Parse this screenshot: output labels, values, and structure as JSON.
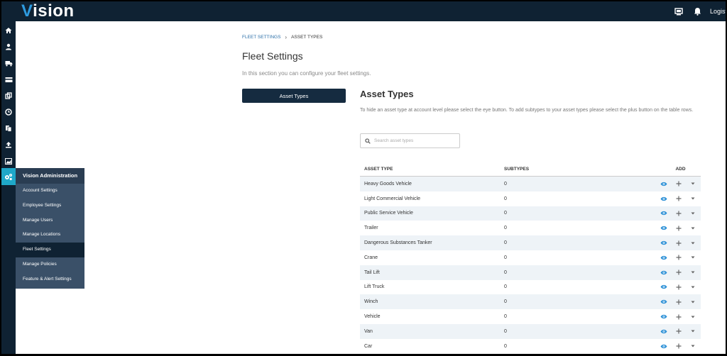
{
  "brand": {
    "logo_v": "V",
    "logo_rest": "ision"
  },
  "topbar": {
    "user_name": "Logistics"
  },
  "nav": {
    "flyout_title": "Vision Administration",
    "flyout_items": [
      {
        "label": "Account Settings"
      },
      {
        "label": "Employee Settings"
      },
      {
        "label": "Manage Users"
      },
      {
        "label": "Manage Locations"
      },
      {
        "label": "Fleet Settings",
        "active": true
      },
      {
        "label": "Manage Policies"
      },
      {
        "label": "Feature & Alert Settings"
      }
    ]
  },
  "breadcrumb": {
    "parent": "FLEET SETTINGS",
    "separator": "›",
    "current": "ASSET TYPES"
  },
  "page": {
    "title": "Fleet Settings",
    "description": "In this section you can configure your fleet settings.",
    "side_button": "Asset Types"
  },
  "asset_types": {
    "title": "Asset Types",
    "description": "To hide an asset type at account level please select the eye button. To add subtypes to your asset types please select the plus button on the table rows.",
    "search_placeholder": "Search asset types",
    "columns": {
      "type": "ASSET TYPE",
      "subtypes": "SUBTYPES",
      "add": "ADD"
    },
    "rows": [
      {
        "type": "Heavy Goods Vehicle",
        "subtypes": "0"
      },
      {
        "type": "Light Commercial Vehicle",
        "subtypes": "0"
      },
      {
        "type": "Public Service Vehicle",
        "subtypes": "0"
      },
      {
        "type": "Trailer",
        "subtypes": "0"
      },
      {
        "type": "Dangerous Substances Tanker",
        "subtypes": "0"
      },
      {
        "type": "Crane",
        "subtypes": "0"
      },
      {
        "type": "Tail Lift",
        "subtypes": "0"
      },
      {
        "type": "Lift Truck",
        "subtypes": "0"
      },
      {
        "type": "Winch",
        "subtypes": "0"
      },
      {
        "type": "Vehicle",
        "subtypes": "0"
      },
      {
        "type": "Van",
        "subtypes": "0"
      },
      {
        "type": "Car",
        "subtypes": "0"
      }
    ]
  },
  "colors": {
    "navy": "#0f2233",
    "accent": "#1fa8c9",
    "eye": "#2a8fd6",
    "flyout": "#3a5068"
  }
}
